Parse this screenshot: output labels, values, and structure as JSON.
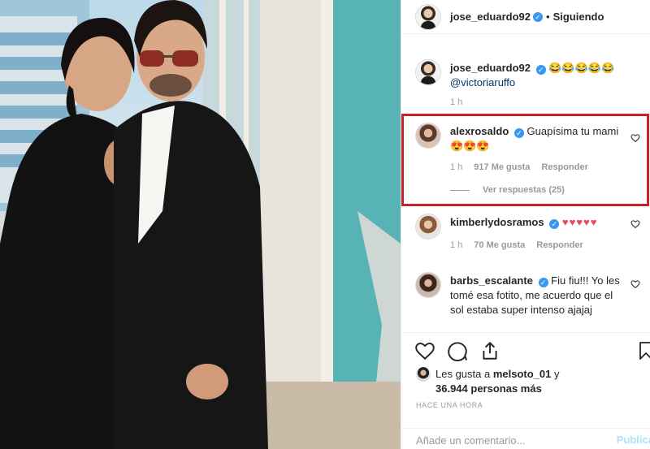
{
  "post": {
    "author": "jose_eduardo92",
    "separator": "•",
    "follow_status": "Siguiendo"
  },
  "caption": {
    "username": "jose_eduardo92",
    "emojis": "😂😂😂😂😂",
    "mention": "@victoriaruffo",
    "time": "1 h"
  },
  "comments": [
    {
      "username": "alexrosaldo",
      "text": "Guapísima tu mami 😍😍😍",
      "time": "1 h",
      "likes": "917 Me gusta",
      "reply": "Responder",
      "view_replies": "Ver respuestas (25)"
    },
    {
      "username": "kimberlydosramos",
      "text": "♥♥♥♥♥",
      "time": "1 h",
      "likes": "70 Me gusta",
      "reply": "Responder"
    },
    {
      "username": "barbs_escalante",
      "text": "Fiu fiu!!! Yo les tomé esa fotito, me acuerdo que el sol estaba super intenso ajajaj"
    }
  ],
  "likes_summary": {
    "prefix": "Les gusta a ",
    "user": "melsoto_01",
    "middle": " y",
    "count": "36.944 personas más"
  },
  "timestamp": "HACE UNA HORA",
  "add_comment": {
    "placeholder": "Añade un comentario...",
    "publish_label": "Publica"
  },
  "icons": {
    "verified": "verified-badge-icon",
    "like": "heart-icon",
    "comment": "comment-icon",
    "share": "share-icon",
    "save": "bookmark-icon"
  },
  "colors": {
    "accent_blue": "#3897f0",
    "heart_red": "#ed4956",
    "highlight_frame": "#c8202c",
    "mention": "#003569"
  }
}
